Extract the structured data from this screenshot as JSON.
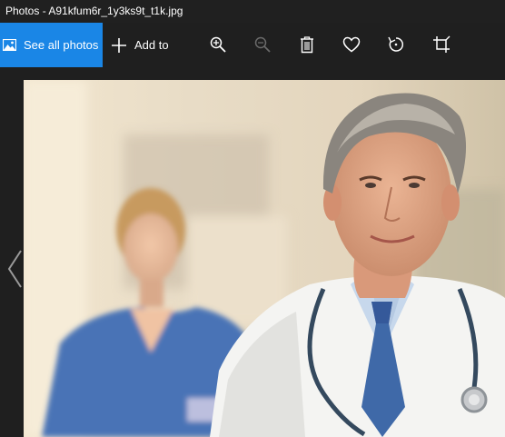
{
  "window": {
    "title": "Photos - A91kfum6r_1y3ks9t_t1k.jpg"
  },
  "toolbar": {
    "see_all_label": "See all photos",
    "add_to_label": "Add to",
    "tools": [
      {
        "name": "zoom-in-icon",
        "enabled": true
      },
      {
        "name": "zoom-out-icon",
        "enabled": false
      },
      {
        "name": "delete-icon",
        "enabled": true
      },
      {
        "name": "favorite-icon",
        "enabled": true
      },
      {
        "name": "rotate-icon",
        "enabled": true
      },
      {
        "name": "crop-icon",
        "enabled": true
      }
    ]
  },
  "viewer": {
    "photo_subject": "Smiling male doctor in white coat with stethoscope, nurse in blue scrubs blurred in background",
    "nav_prev_icon": "chevron-left-icon"
  },
  "colors": {
    "accent": "#1a86e6",
    "background": "#1f1f1f",
    "titlebar": "#202020"
  }
}
